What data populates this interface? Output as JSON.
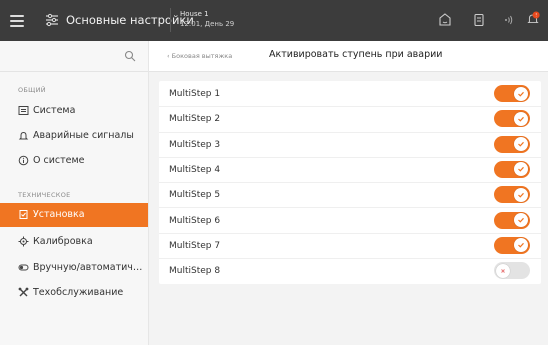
{
  "topbar": {
    "title": "Основные настройки",
    "house_name": "House 1",
    "house_time": "12:01, День 29"
  },
  "sidebar": {
    "sections": [
      {
        "header": "ОБЩИЙ",
        "items": [
          "Система",
          "Аварийные сигналы",
          "О системе"
        ]
      },
      {
        "header": "ТЕХНИЧЕСКОЕ",
        "items": [
          "Установка",
          "Калибровка",
          "Вручную/автоматиче...",
          "Техобслуживание"
        ]
      }
    ],
    "active_item": "Установка"
  },
  "main": {
    "back_label": "‹ Боковая вытяжка",
    "title": "Активировать ступень при аварии",
    "rows": [
      {
        "label": "MultiStep 1",
        "on": true
      },
      {
        "label": "MultiStep 2",
        "on": true
      },
      {
        "label": "MultiStep 3",
        "on": true
      },
      {
        "label": "MultiStep 4",
        "on": true
      },
      {
        "label": "MultiStep 5",
        "on": true
      },
      {
        "label": "MultiStep 6",
        "on": true
      },
      {
        "label": "MultiStep 7",
        "on": true
      },
      {
        "label": "MultiStep 8",
        "on": false
      }
    ]
  },
  "colors": {
    "accent": "#f07522",
    "topbar": "#3c3c3c",
    "alert": "#e8491d"
  },
  "icons": {
    "topbar": [
      "menu-icon",
      "settings-sliders-icon",
      "face-icon",
      "document-icon",
      "wireless-icon",
      "alarm-bell-icon"
    ],
    "sidebar": [
      "system-icon",
      "alarm-icon",
      "info-icon",
      "installation-icon",
      "calibration-icon",
      "manual-auto-icon",
      "maintenance-icon"
    ]
  }
}
